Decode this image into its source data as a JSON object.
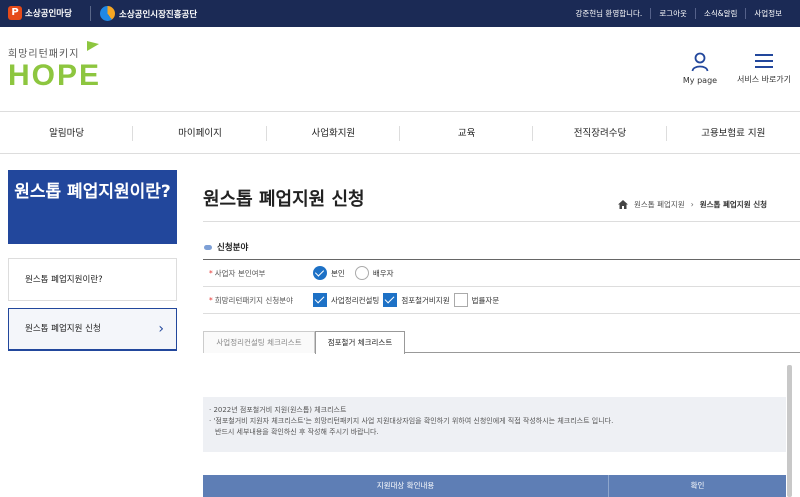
{
  "topbar": {
    "brand1": "소상공인마당",
    "brand2": "소상공인시장진흥공단",
    "util": [
      "강준현님 환영합니다.",
      "로그아웃",
      "소식&알림",
      "사업정보"
    ]
  },
  "header": {
    "logo_sub": "희망리턴패키지",
    "logo_main": "HOPE",
    "mypage_label": "My page",
    "service_label": "서비스 바로가기"
  },
  "gnb": [
    "알림마당",
    "마이페이지",
    "사업화지원",
    "교육",
    "전직장려수당",
    "고용보험료 지원"
  ],
  "sidebar": {
    "title": "원스톱 폐업지원이란?",
    "items": [
      {
        "label": "원스톱 폐업지원이란?"
      },
      {
        "label": "원스톱 폐업지원 신청"
      }
    ]
  },
  "main": {
    "page_title": "원스톱 폐업지원 신청",
    "breadcrumb": [
      "원스톱 폐업지원",
      "원스톱 폐업지원 신청"
    ],
    "section_title": "신청분야",
    "form": {
      "row1": {
        "label": "사업자 본인여부",
        "opt1": "본인",
        "opt2": "배우자"
      },
      "row2": {
        "label": "희망리턴패키지 신청분야",
        "opt1": "사업정리컨설팅",
        "opt2": "점포철거비지원",
        "opt3": "법률자문"
      }
    },
    "tabs": [
      "사업정리컨설팅 체크리스트",
      "점포철거 체크리스트"
    ],
    "notice": {
      "line1": "· 2022년 점포철거비 지원(원스톱) 체크리스트",
      "line2": "· '점포철거비 지원자 체크리스트'는 희망리턴패키지 사업 지원대상자임을 확인하기 위하여 신청인에게 직접 작성하시는 체크리스트 입니다.",
      "line3": "반드시 세부내용을 확인하신 후 작성해 주시기 바랍니다."
    },
    "table": {
      "col1": "지원대상 확인내용",
      "col2": "확인"
    }
  }
}
